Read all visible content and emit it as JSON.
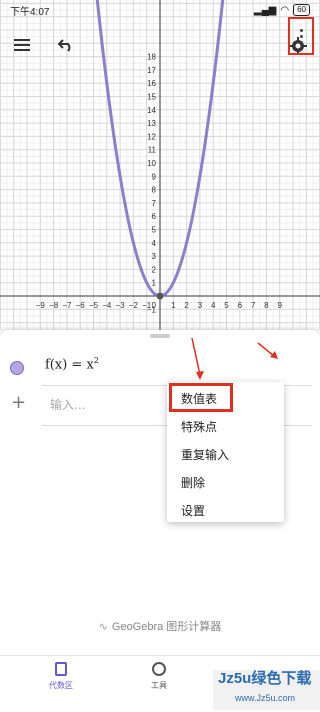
{
  "status_bar": {
    "time": "下午4:07",
    "battery": "60"
  },
  "toolbar": {
    "menu_icon": "hamburger-icon",
    "undo_icon": "undo-icon",
    "settings_icon": "gear-icon"
  },
  "graph": {
    "x_ticks": [
      "−9",
      "−8",
      "−7",
      "−6",
      "−5",
      "−4",
      "−3",
      "−2",
      "−1",
      "1",
      "2",
      "3",
      "4",
      "5",
      "6",
      "7",
      "8",
      "9"
    ],
    "y_ticks": [
      "1",
      "2",
      "3",
      "4",
      "5",
      "6",
      "7",
      "8",
      "9",
      "10",
      "11",
      "12",
      "13",
      "14",
      "15",
      "16",
      "17",
      "18"
    ],
    "y_neg_ticks": [
      "−1"
    ],
    "origin_label": "0",
    "curve_color": "#7b67c4"
  },
  "algebra": {
    "func_prefix": "f(x) = x",
    "func_exp": "2",
    "input_placeholder": "输入..."
  },
  "context_menu": {
    "items": [
      "数值表",
      "特殊点",
      "重复输入",
      "删除",
      "设置"
    ]
  },
  "brand": "GeoGebra 图形计算器",
  "bottom_nav": {
    "algebra": "代数区",
    "tools": "工具"
  },
  "watermark": {
    "big": "Jz5u绿色下载",
    "small": "www.Jz5u.com"
  },
  "colors": {
    "accent": "#6557d2",
    "highlight_red": "#e0301e"
  }
}
